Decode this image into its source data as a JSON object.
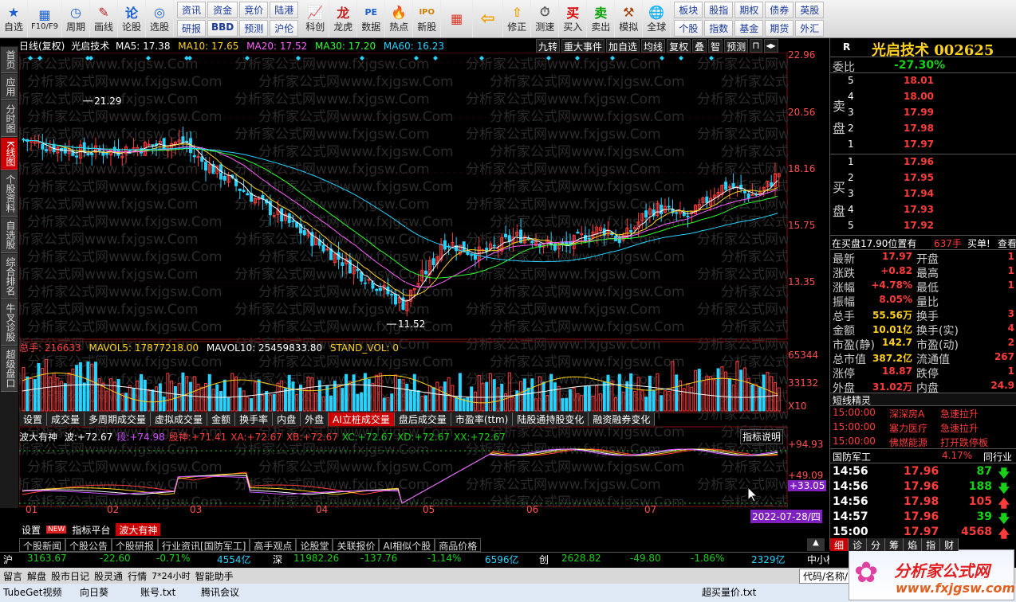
{
  "toolbar": {
    "items": [
      "自选",
      "周期",
      "画线",
      "论股",
      "选股"
    ],
    "sub": "F10/F9",
    "grid1": [
      [
        "资讯",
        "资金",
        "竞价",
        "陆港"
      ],
      [
        "研报",
        "BBD",
        "预测",
        "沪伦"
      ]
    ],
    "items2": [
      "科创",
      "龙虎",
      "数据",
      "热点",
      "新股"
    ],
    "items3": [
      "修正",
      "测速"
    ],
    "trade": [
      "买入",
      "卖出",
      "模拟"
    ],
    "global": "全球",
    "grid2": [
      [
        "板块",
        "股指",
        "期权",
        "债券",
        "英股"
      ],
      [
        "个股",
        "指数",
        "基金",
        "期货",
        "外汇"
      ]
    ]
  },
  "leftnav": [
    "首页",
    "应用",
    "分时图",
    "K线图",
    "个股资料",
    "自选股",
    "综合排名",
    "牛叉诊股",
    "超级盘口"
  ],
  "chart": {
    "title": "日线(复权)",
    "stock": "光启技术",
    "ma": [
      {
        "label": "MA5: 17.38",
        "color": "#ffffff"
      },
      {
        "label": "MA10: 17.65",
        "color": "#ffd21e"
      },
      {
        "label": "MA20: 17.52",
        "color": "#ff60ff"
      },
      {
        "label": "MA30: 17.20",
        "color": "#30ff30"
      },
      {
        "label": "MA60: 16.23",
        "color": "#27d3ff"
      }
    ],
    "links": [
      "九转",
      "重大事件",
      "加自选",
      "均线",
      "复权",
      "叠",
      "智",
      "预测"
    ],
    "axis": [
      "22.96",
      "20.56",
      "18.16",
      "15.75",
      "13.35"
    ],
    "hi": "21.29",
    "lo": "11.52",
    "vol_axis": [
      "65344",
      "33132",
      "X10"
    ],
    "ind_axis": [
      "+94.93",
      "+49.09",
      "+33.05"
    ],
    "months": [
      "01",
      "02",
      "03",
      "04",
      "05",
      "06",
      "07"
    ],
    "date": "2022-07-28/四",
    "watermark": "分析家公式网www.fxjgsw.Com"
  },
  "volume": {
    "label": "总手: 216633",
    "mavol5": "MAVOL5: 17877218.00",
    "mavol10": "MAVOL10: 25459833.80",
    "std": "STAND_VOL: 0"
  },
  "tabs": [
    "设置",
    "成交量",
    "多周期成交量",
    "虚拟成交量",
    "金额",
    "换手率",
    "内盘",
    "外盘",
    "AI立桩成交量",
    "盘后成交量",
    "市盈率(ttm)",
    "陆股通持股变化",
    "融资融券变化"
  ],
  "indicator": {
    "name": "波大有神",
    "vals": [
      {
        "l": "波:",
        "v": "+72.67"
      },
      {
        "l": "段:",
        "v": "+74.98"
      },
      {
        "l": "股神:",
        "v": "+71.41"
      },
      {
        "l": "XA:",
        "v": "+72.67"
      },
      {
        "l": "XB:",
        "v": "+72.67"
      },
      {
        "l": "XC:",
        "v": "+72.67"
      },
      {
        "l": "XD:",
        "v": "+72.67"
      },
      {
        "l": "XX:",
        "v": "+72.67"
      }
    ],
    "help": "指标说明"
  },
  "btabs": [
    "设置",
    "NEW",
    "指标平台",
    "波大有神"
  ],
  "news": [
    "个股新闻",
    "个股公告",
    "个股研报",
    "行业资讯[国防军工]",
    "高手观点",
    "论股堂",
    "关联报价",
    "AI相似个股",
    "商品价格"
  ],
  "status": {
    "sh": "沪",
    "sh_idx": "3163.67",
    "sh_chg": "-22.60",
    "sh_pct": "-0.71%",
    "sh_amt": "4554亿",
    "sz": "深",
    "sz_idx": "11982.26",
    "sz_chg": "-137.76",
    "sz_pct": "-1.14%",
    "sz_amt": "6596亿",
    "cy": "创",
    "cy_idx": "2628.82",
    "cy_chg": "-49.80",
    "cy_pct": "-1.86%",
    "cy_amt": "2329亿",
    "zx": "中小板指"
  },
  "bottom": [
    "留言",
    "解盘",
    "股市日记",
    "股灵通",
    "行情",
    "7*24小时",
    "智能助手"
  ],
  "code_search": "代码/名称/",
  "panel": {
    "title": "光启技术 002625",
    "r": "R",
    "weibi_l": "委比",
    "weibi": "-27.30%",
    "sell_l": "卖盘",
    "buy_l": "买盘",
    "asks": [
      {
        "n": "5",
        "p": "18.01"
      },
      {
        "n": "4",
        "p": "18.00"
      },
      {
        "n": "3",
        "p": "17.99"
      },
      {
        "n": "2",
        "p": "17.98"
      },
      {
        "n": "1",
        "p": "17.97"
      }
    ],
    "bids": [
      {
        "n": "1",
        "p": "17.96"
      },
      {
        "n": "2",
        "p": "17.95"
      },
      {
        "n": "3",
        "p": "17.94"
      },
      {
        "n": "4",
        "p": "17.93"
      },
      {
        "n": "5",
        "p": "17.92"
      }
    ],
    "note": "在买盘17.90位置有",
    "note2": "637手",
    "note3": "买单!",
    "note4": "查看",
    "stats": [
      [
        "最新",
        "17.97",
        "开盘",
        "1"
      ],
      [
        "涨跌",
        "+0.82",
        "最高",
        "1"
      ],
      [
        "涨幅",
        "+4.78%",
        "最低",
        "1"
      ],
      [
        "振幅",
        "8.05%",
        "量比",
        ""
      ],
      [
        "总手",
        "55.56万",
        "换手",
        "3"
      ],
      [
        "金额",
        "10.01亿",
        "换手(实)",
        "4"
      ],
      [
        "市盈(静)",
        "142.7",
        "市盈(动)",
        "2"
      ],
      [
        "总市值",
        "387.2亿",
        "流通值",
        "267"
      ],
      [
        "涨停",
        "18.87",
        "跌停",
        "1"
      ],
      [
        "外盘",
        "31.02万",
        "内盘",
        "24.9"
      ]
    ],
    "sprite_title": "短线精灵",
    "sprites": [
      {
        "t": "15:00:00",
        "n": "深深房A",
        "e": "急速拉升"
      },
      {
        "t": "15:00:00",
        "n": "塞力医疗",
        "e": "急速拉升"
      },
      {
        "t": "15:00:00",
        "n": "佛燃能源",
        "e": "打开跌停板"
      }
    ],
    "industry": "国防军工",
    "industry_pct": "4.17%",
    "industry_more": "同行业",
    "ticks": [
      {
        "t": "14:56",
        "p": "17.96",
        "v": "87",
        "d": "down"
      },
      {
        "t": "14:56",
        "p": "17.96",
        "v": "188",
        "d": "down"
      },
      {
        "t": "14:56",
        "p": "17.98",
        "v": "105",
        "d": "up"
      },
      {
        "t": "14:57",
        "p": "17.96",
        "v": "39",
        "d": "down"
      },
      {
        "t": "15:00",
        "p": "17.97",
        "v": "4568",
        "d": "up"
      }
    ],
    "btabs": [
      "细",
      "诊",
      "分",
      "筹",
      "焰",
      "指",
      "财"
    ]
  },
  "taskbar": [
    "TubeGet视频",
    "向日葵",
    "账号.txt",
    "腾讯会议",
    "超买量价.txt"
  ],
  "logo_url": "www.fxjgsw.com",
  "logo_name": "分析家公式网"
}
